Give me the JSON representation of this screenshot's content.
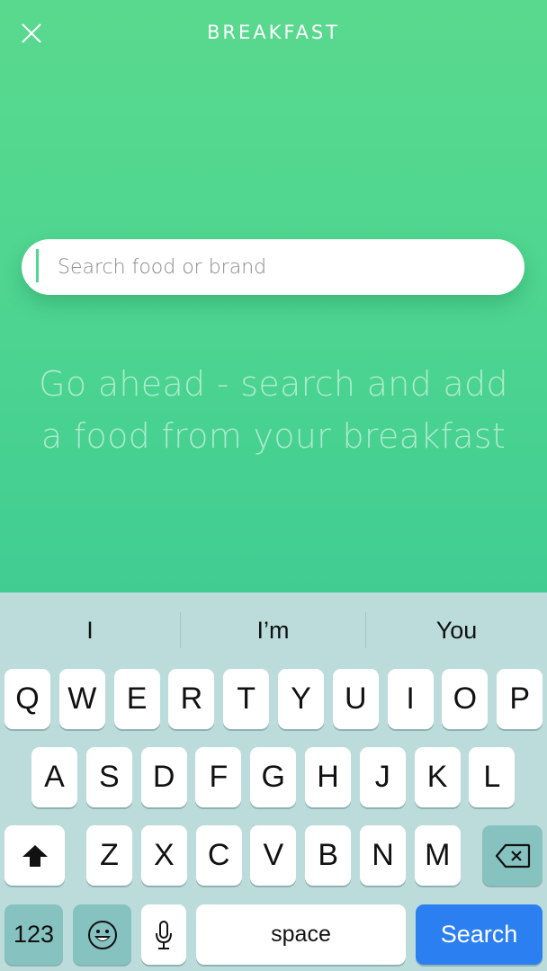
{
  "header": {
    "title": "BREAKFAST",
    "close_icon": "close-icon"
  },
  "search": {
    "placeholder": "Search food or brand",
    "value": ""
  },
  "hint": {
    "line1": "Go ahead - search and add",
    "line2": "a food from your breakfast"
  },
  "keyboard": {
    "suggestions": [
      "I",
      "I’m",
      "You"
    ],
    "row1": [
      "Q",
      "W",
      "E",
      "R",
      "T",
      "Y",
      "U",
      "I",
      "O",
      "P"
    ],
    "row2": [
      "A",
      "S",
      "D",
      "F",
      "G",
      "H",
      "J",
      "K",
      "L"
    ],
    "row3": [
      "Z",
      "X",
      "C",
      "V",
      "B",
      "N",
      "M"
    ],
    "shift_icon": "shift-icon",
    "delete_icon": "backspace-icon",
    "numbers_label": "123",
    "emoji_icon": "emoji-icon",
    "mic_icon": "microphone-icon",
    "space_label": "space",
    "return_label": "Search"
  },
  "colors": {
    "accent_green": "#4fd690",
    "return_blue": "#2b7ff1",
    "keyboard_bg": "#bcdcdc",
    "dark_key": "#86c2c0"
  }
}
